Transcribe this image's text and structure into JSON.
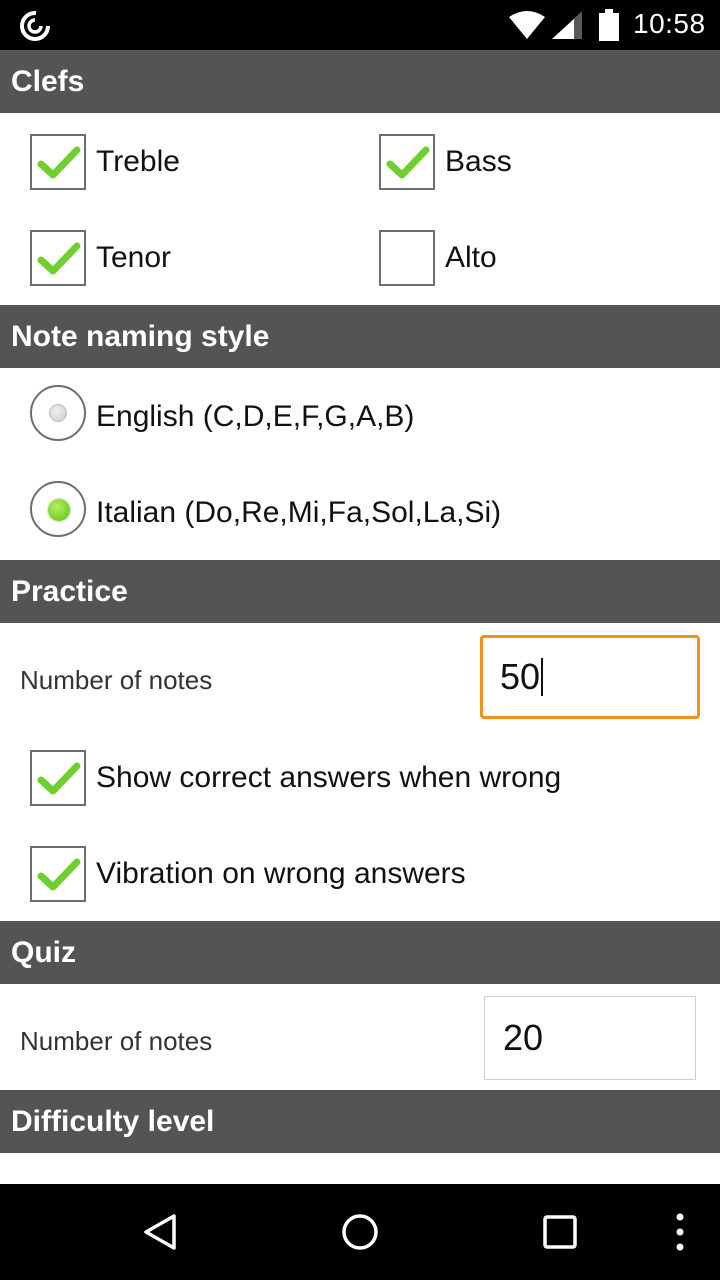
{
  "status_bar": {
    "time": "10:58",
    "icons": [
      "app-logo-icon",
      "wifi-icon",
      "signal-icon",
      "battery-icon"
    ]
  },
  "sections": {
    "clefs": {
      "title": "Clefs",
      "options": [
        {
          "label": "Treble",
          "checked": true
        },
        {
          "label": "Bass",
          "checked": true
        },
        {
          "label": "Tenor",
          "checked": true
        },
        {
          "label": "Alto",
          "checked": false
        }
      ]
    },
    "naming": {
      "title": "Note naming style",
      "options": [
        {
          "label": "English (C,D,E,F,G,A,B)",
          "selected": false
        },
        {
          "label": "Italian (Do,Re,Mi,Fa,Sol,La,Si)",
          "selected": true
        }
      ]
    },
    "practice": {
      "title": "Practice",
      "notes_label": "Number of notes",
      "notes_value": "50",
      "options": [
        {
          "label": "Show correct answers when wrong",
          "checked": true
        },
        {
          "label": "Vibration on wrong answers",
          "checked": true
        }
      ]
    },
    "quiz": {
      "title": "Quiz",
      "notes_label": "Number of notes",
      "notes_value": "20"
    },
    "difficulty": {
      "title": "Difficulty level"
    }
  },
  "nav_bar": {
    "icons": [
      "back-icon",
      "home-icon",
      "recents-icon",
      "overflow-menu-icon"
    ]
  },
  "colors": {
    "header_bg": "#545454",
    "check_green": "#6fcf2c",
    "focus_orange": "#f0921c"
  }
}
